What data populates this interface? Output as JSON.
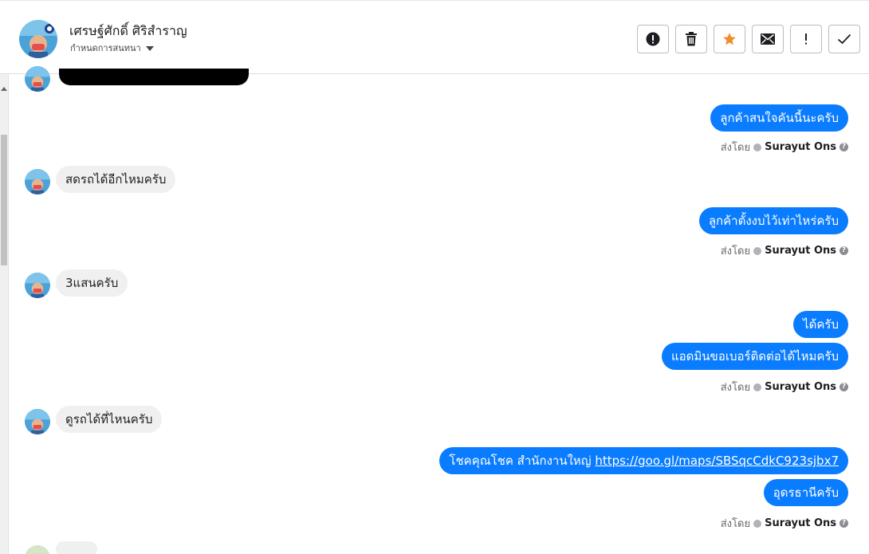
{
  "header": {
    "contact_name": "เศรษฐ์ศักดิ์ ศิริสำราญ",
    "assign_label": "กำหนดการสนทนา",
    "toolbar": {
      "buttons": [
        {
          "icon": "exclamation-circle-icon"
        },
        {
          "icon": "trash-icon"
        },
        {
          "icon": "star-icon"
        },
        {
          "icon": "envelope-icon"
        },
        {
          "icon": "exclamation-mark-icon"
        },
        {
          "icon": "checkmark-icon"
        }
      ]
    }
  },
  "colors": {
    "outgoing_bubble": "#0a7cff",
    "incoming_bubble": "#f0f0f0",
    "star": "#f28c28"
  },
  "messages": [
    {
      "dir": "out",
      "text": "ลูกค้าสนใจคันนี้นะครับ"
    },
    {
      "dir": "in",
      "text": "สดรถได้อีกไหมครับ"
    },
    {
      "dir": "out",
      "text": "ลูกค้าตั้งงบไว้เท่าไหร่ครับ"
    },
    {
      "dir": "in",
      "text": "3แสนครับ"
    },
    {
      "dir": "out",
      "text": "ได้ครับ"
    },
    {
      "dir": "out",
      "text": "แอดมินขอเบอร์ติดต่อได้ไหมครับ"
    },
    {
      "dir": "in",
      "text": "ดูรถได้ที่ไหนครับ"
    },
    {
      "dir": "out",
      "text": "โชคคุณโชค สำนักงานใหญ่ ",
      "link": "https://goo.gl/maps/SBSqcCdkC923sjbx7"
    },
    {
      "dir": "out",
      "text": "อุดรธานีครับ"
    }
  ],
  "sent_by": {
    "label": "ส่งโดย",
    "name": "Surayut Ons"
  }
}
